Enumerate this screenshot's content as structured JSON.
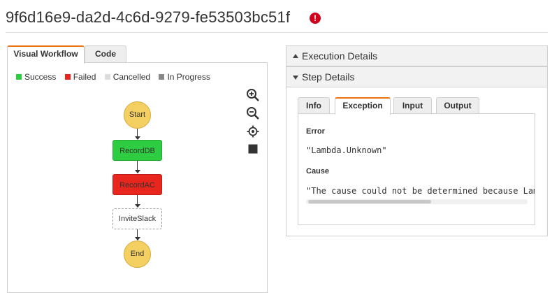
{
  "header": {
    "execution_name": "9f6d16e9-da2d-4c6d-9279-fe53503bc51f",
    "status_icon": "error-icon",
    "status_color": "#d0021b"
  },
  "left_panel": {
    "tabs": [
      {
        "label": "Visual Workflow",
        "active": true
      },
      {
        "label": "Code",
        "active": false
      }
    ],
    "legend": [
      {
        "label": "Success",
        "color": "#2ecc40"
      },
      {
        "label": "Failed",
        "color": "#e8261d"
      },
      {
        "label": "Cancelled",
        "color": "#dddddd"
      },
      {
        "label": "In Progress",
        "color": "#888888"
      }
    ],
    "graph_tools": [
      "zoom-in-icon",
      "zoom-out-icon",
      "center-icon",
      "stop-icon"
    ],
    "workflow": {
      "nodes": [
        {
          "label": "Start",
          "shape": "circle",
          "status": "start"
        },
        {
          "label": "RecordDB",
          "shape": "rect",
          "status": "success"
        },
        {
          "label": "RecordAC",
          "shape": "rect",
          "status": "failed"
        },
        {
          "label": "InviteSlack",
          "shape": "rect",
          "status": "not-started"
        },
        {
          "label": "End",
          "shape": "circle",
          "status": "end"
        }
      ],
      "colors": {
        "success": "#2ecc40",
        "failed": "#e8261d",
        "terminal": "#f4cf62"
      }
    }
  },
  "right_panel": {
    "sections": [
      {
        "label": "Execution Details",
        "expanded": false
      },
      {
        "label": "Step Details",
        "expanded": true
      }
    ],
    "step_tabs": [
      {
        "label": "Info",
        "active": false
      },
      {
        "label": "Exception",
        "active": true
      },
      {
        "label": "Input",
        "active": false
      },
      {
        "label": "Output",
        "active": false
      }
    ],
    "exception": {
      "error_label": "Error",
      "error_value": "\"Lambda.Unknown\"",
      "cause_label": "Cause",
      "cause_value": "\"The cause could not be determined because Lam"
    },
    "accent_color": "#ec7211"
  }
}
